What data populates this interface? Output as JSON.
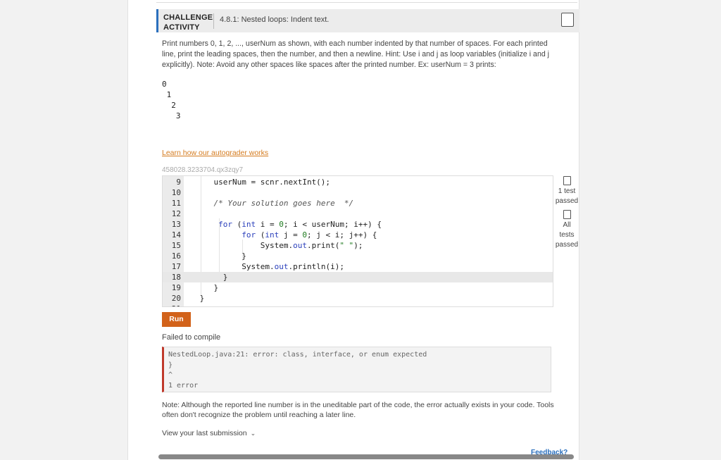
{
  "header": {
    "category": "CHALLENGE ACTIVITY",
    "title": "4.8.1: Nested loops: Indent text."
  },
  "description": "Print numbers 0, 1, 2, ..., userNum as shown, with each number indented by that number of spaces. For each printed line, print the leading spaces, then the number, and then a newline. Hint: Use i and j as loop variables (initialize i and j explicitly). Note: Avoid any other spaces like spaces after the printed number. Ex: userNum = 3 prints:",
  "example_output": "0\n 1\n  2\n   3",
  "learn_link": "Learn how our autograder works",
  "code_id": "458028.3233704.qx3zqy7",
  "status": {
    "test1": "1 test passed",
    "test2": "All tests passed"
  },
  "run_label": "Run",
  "fail_message": "Failed to compile",
  "error_text": "NestedLoop.java:21: error: class, interface, or enum expected\n}\n^\n1 error",
  "note": "Note: Although the reported line number is in the uneditable part of the code, the error actually exists in your code. Tools often don't recognize the problem until reaching a later line.",
  "view_last": "View your last submission",
  "feedback": "Feedback?",
  "colors": {
    "accent_blue": "#2a6fbd",
    "run_orange": "#d2621a",
    "link_orange": "#d47b1f",
    "error_red": "#c0392b"
  }
}
